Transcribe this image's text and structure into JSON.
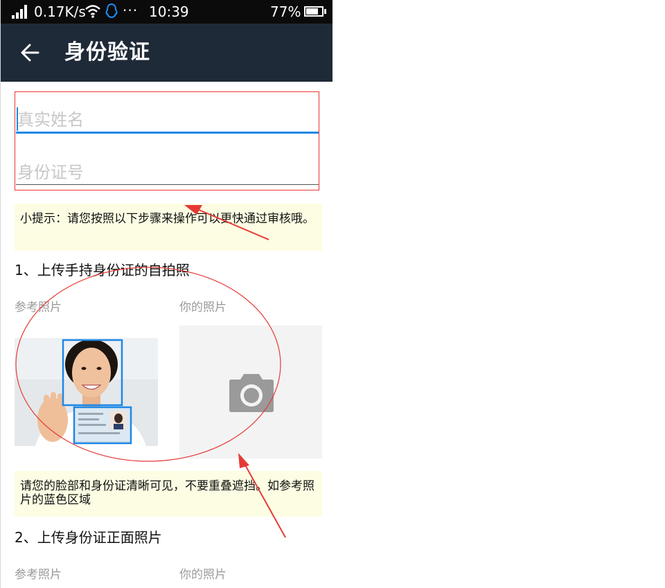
{
  "status_bar": {
    "network_speed": "0.17K/s",
    "dots": "···",
    "time": "10:39",
    "battery_percent": "77%",
    "battery_level": 0.77
  },
  "app_bar": {
    "title": "身份验证"
  },
  "form": {
    "name_placeholder": "真实姓名",
    "id_placeholder": "身份证号"
  },
  "tips": {
    "tip1": "小提示：请您按照以下步骤来操作可以更快通过审核哦。",
    "tip2": "请您的脸部和身份证清晰可见，不要重叠遮挡。如参考照片的蓝色区域"
  },
  "step1": {
    "heading": "1、上传手持身份证的自拍照",
    "reference_label": "参考照片",
    "yours_label": "你的照片"
  },
  "step2": {
    "heading": "2、上传身份证正面照片",
    "reference_label": "参考照片",
    "yours_label": "你的照片"
  },
  "colors": {
    "app_bar": "#1f2a38",
    "accent_blue": "#1e88e5",
    "tip_background": "#fdfde3",
    "annotation_red": "#e53935"
  }
}
